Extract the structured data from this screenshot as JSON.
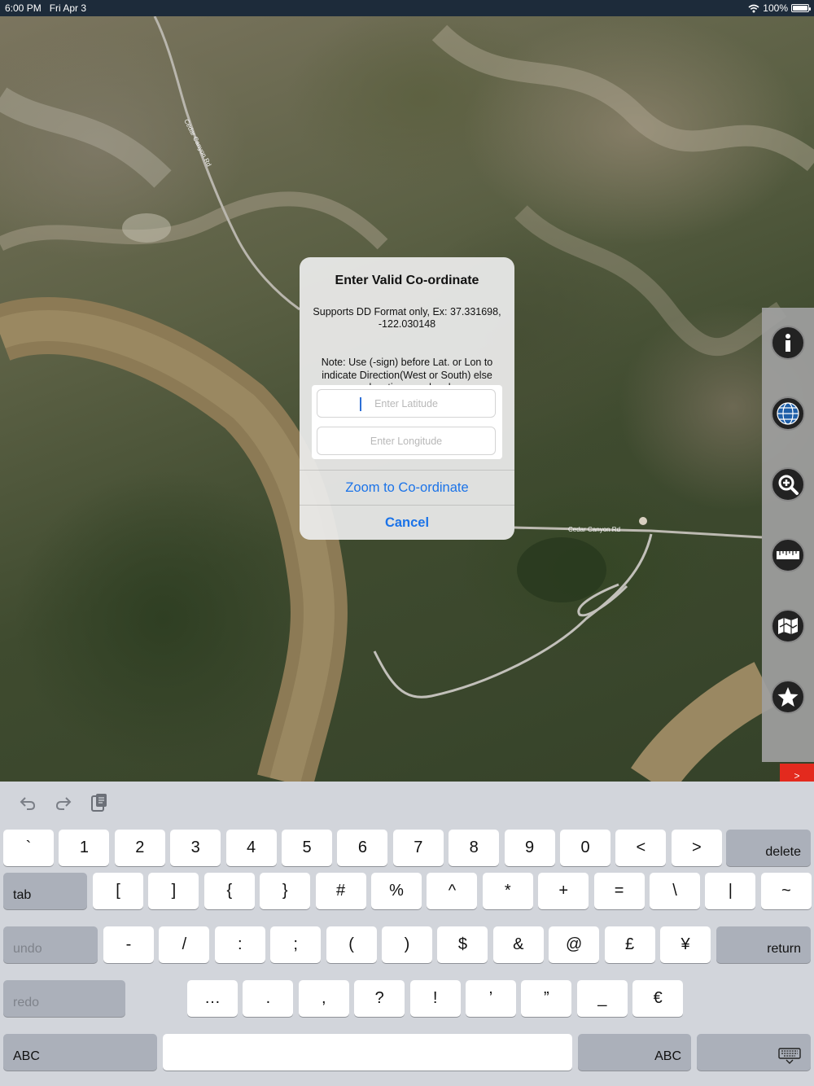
{
  "status_bar": {
    "time": "6:00 PM",
    "date": "Fri Apr 3",
    "battery": "100%",
    "battery_level": 1.0
  },
  "map": {
    "road_label_1": "Cedar Canyon Rd",
    "road_label_2": "Cedar Canyon Rd"
  },
  "side_toolbar": {
    "buttons": [
      {
        "icon": "info-icon"
      },
      {
        "icon": "globe-icon"
      },
      {
        "icon": "zoom-in-icon"
      },
      {
        "icon": "ruler-icon"
      },
      {
        "icon": "map-layers-icon"
      },
      {
        "icon": "star-icon"
      }
    ],
    "toggle_label": ">",
    "toggle_color": "#e32a1e"
  },
  "alert": {
    "title": "Enter Valid Co-ordinate",
    "message_line1": "Supports DD Format only, Ex: 37.331698, -122.030148",
    "message_line2": "Note: Use (-sign) before Lat. or Lon to indicate Direction(West or South) else wrong location may be shown.",
    "latitude_placeholder": "Enter Latitude",
    "longitude_placeholder": "Enter Longitude",
    "zoom_button": "Zoom to Co-ordinate",
    "cancel_button": "Cancel",
    "accent_color": "#1b73e8"
  },
  "keyboard": {
    "toolbar": [
      "undo-icon",
      "redo-icon",
      "paste-icon"
    ],
    "row1": [
      "`",
      "1",
      "2",
      "3",
      "4",
      "5",
      "6",
      "7",
      "8",
      "9",
      "0",
      "<",
      ">"
    ],
    "delete": "delete",
    "tab": "tab",
    "row2": [
      "[",
      "]",
      "{",
      "}",
      "#",
      "%",
      "^",
      "*",
      "+",
      "=",
      "\\",
      "|",
      "~"
    ],
    "undo": "undo",
    "row3": [
      "-",
      "/",
      ":",
      ";",
      "(",
      ")",
      "$",
      "&",
      "@",
      "£",
      "¥"
    ],
    "return": "return",
    "redo": "redo",
    "row4": [
      "…",
      ".",
      ",",
      "?",
      "!",
      "’",
      "”",
      "_",
      "€"
    ],
    "abc_left": "ABC",
    "abc_right": "ABC",
    "dismiss_icon": "keyboard-dismiss-icon"
  }
}
